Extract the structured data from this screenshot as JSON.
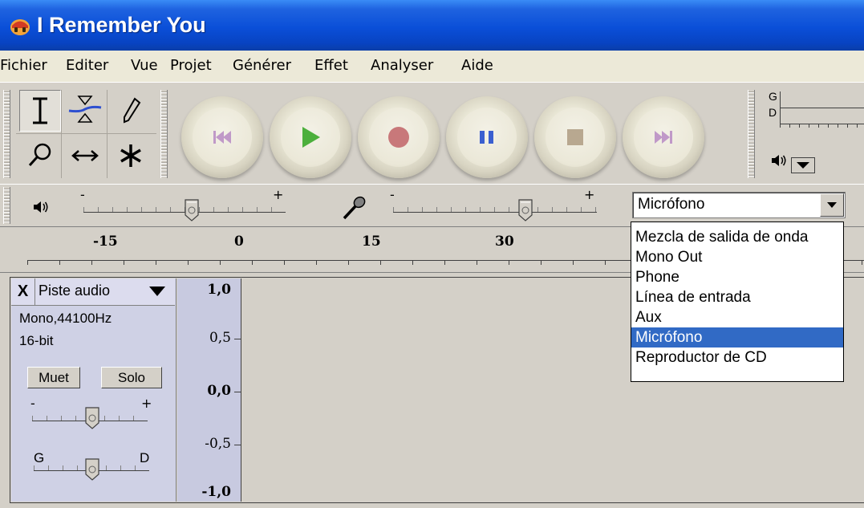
{
  "window": {
    "title": "I Remember You"
  },
  "menu": {
    "items": [
      "Fichier",
      "Editer",
      "Vue",
      "Projet",
      "Générer",
      "Effet",
      "Analyser",
      "Aide"
    ]
  },
  "tools": [
    {
      "name": "selection-tool-icon"
    },
    {
      "name": "envelope-tool-icon"
    },
    {
      "name": "draw-tool-icon"
    },
    {
      "name": "zoom-tool-icon"
    },
    {
      "name": "time-shift-tool-icon"
    },
    {
      "name": "multi-tool-icon"
    }
  ],
  "transport": [
    {
      "name": "skip-to-start-icon",
      "color": "#c099c8"
    },
    {
      "name": "play-icon",
      "color": "#4caf3c"
    },
    {
      "name": "record-icon",
      "color": "#c8787a"
    },
    {
      "name": "pause-icon",
      "color": "#3a5fd0"
    },
    {
      "name": "stop-icon",
      "color": "#b8a890"
    },
    {
      "name": "skip-to-end-icon",
      "color": "#c099c8"
    }
  ],
  "meter": {
    "left_label": "G",
    "right_label": "D"
  },
  "mixer": {
    "output_minus": "-",
    "output_plus": "+",
    "input_minus": "-",
    "input_plus": "+",
    "input_source": "Micrófono"
  },
  "ruler": {
    "labels": [
      "-15",
      "0",
      "15",
      "30"
    ]
  },
  "track": {
    "name": "Piste audio",
    "close": "X",
    "format": "Mono,44100Hz",
    "bitdepth": "16-bit",
    "mute_label": "Muet",
    "solo_label": "Solo",
    "gain_minus": "-",
    "gain_plus": "+",
    "pan_left": "G",
    "pan_right": "D",
    "scale": [
      "1,0",
      "0,5",
      "0,0",
      "-0,5",
      "-1,0"
    ]
  },
  "dropdown": {
    "options": [
      "Mezcla de salida de onda",
      "Mono Out",
      "Phone",
      "Línea de entrada",
      "Aux",
      "Micrófono",
      "Reproductor de CD"
    ],
    "selected": "Micrófono"
  }
}
